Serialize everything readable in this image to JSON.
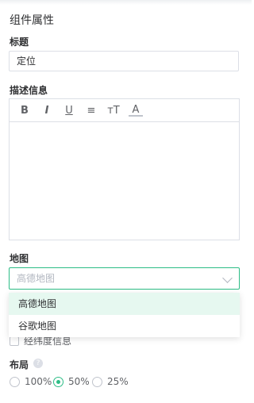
{
  "panel": {
    "title": "组件属性"
  },
  "title_field": {
    "label": "标题",
    "value": "定位"
  },
  "description": {
    "label": "描述信息",
    "toolbar": [
      {
        "name": "bold-icon",
        "glyph": "B"
      },
      {
        "name": "italic-icon",
        "glyph": "I"
      },
      {
        "name": "underline-icon",
        "glyph": "U"
      },
      {
        "name": "align-icon",
        "glyph": "≡"
      },
      {
        "name": "font-size-icon",
        "glyph": "тT"
      },
      {
        "name": "font-color-icon",
        "glyph": "A"
      }
    ]
  },
  "map": {
    "label": "地图",
    "placeholder": "高德地图",
    "options": [
      "高德地图",
      "谷歌地图"
    ],
    "checkbox_label": "经纬度信息"
  },
  "layout": {
    "label": "布局",
    "help_glyph": "?",
    "options": [
      "100%",
      "50%",
      "25%"
    ],
    "selected": "50%"
  },
  "colors": {
    "accent": "#2dbd86",
    "highlight": "#e6f8f0"
  }
}
